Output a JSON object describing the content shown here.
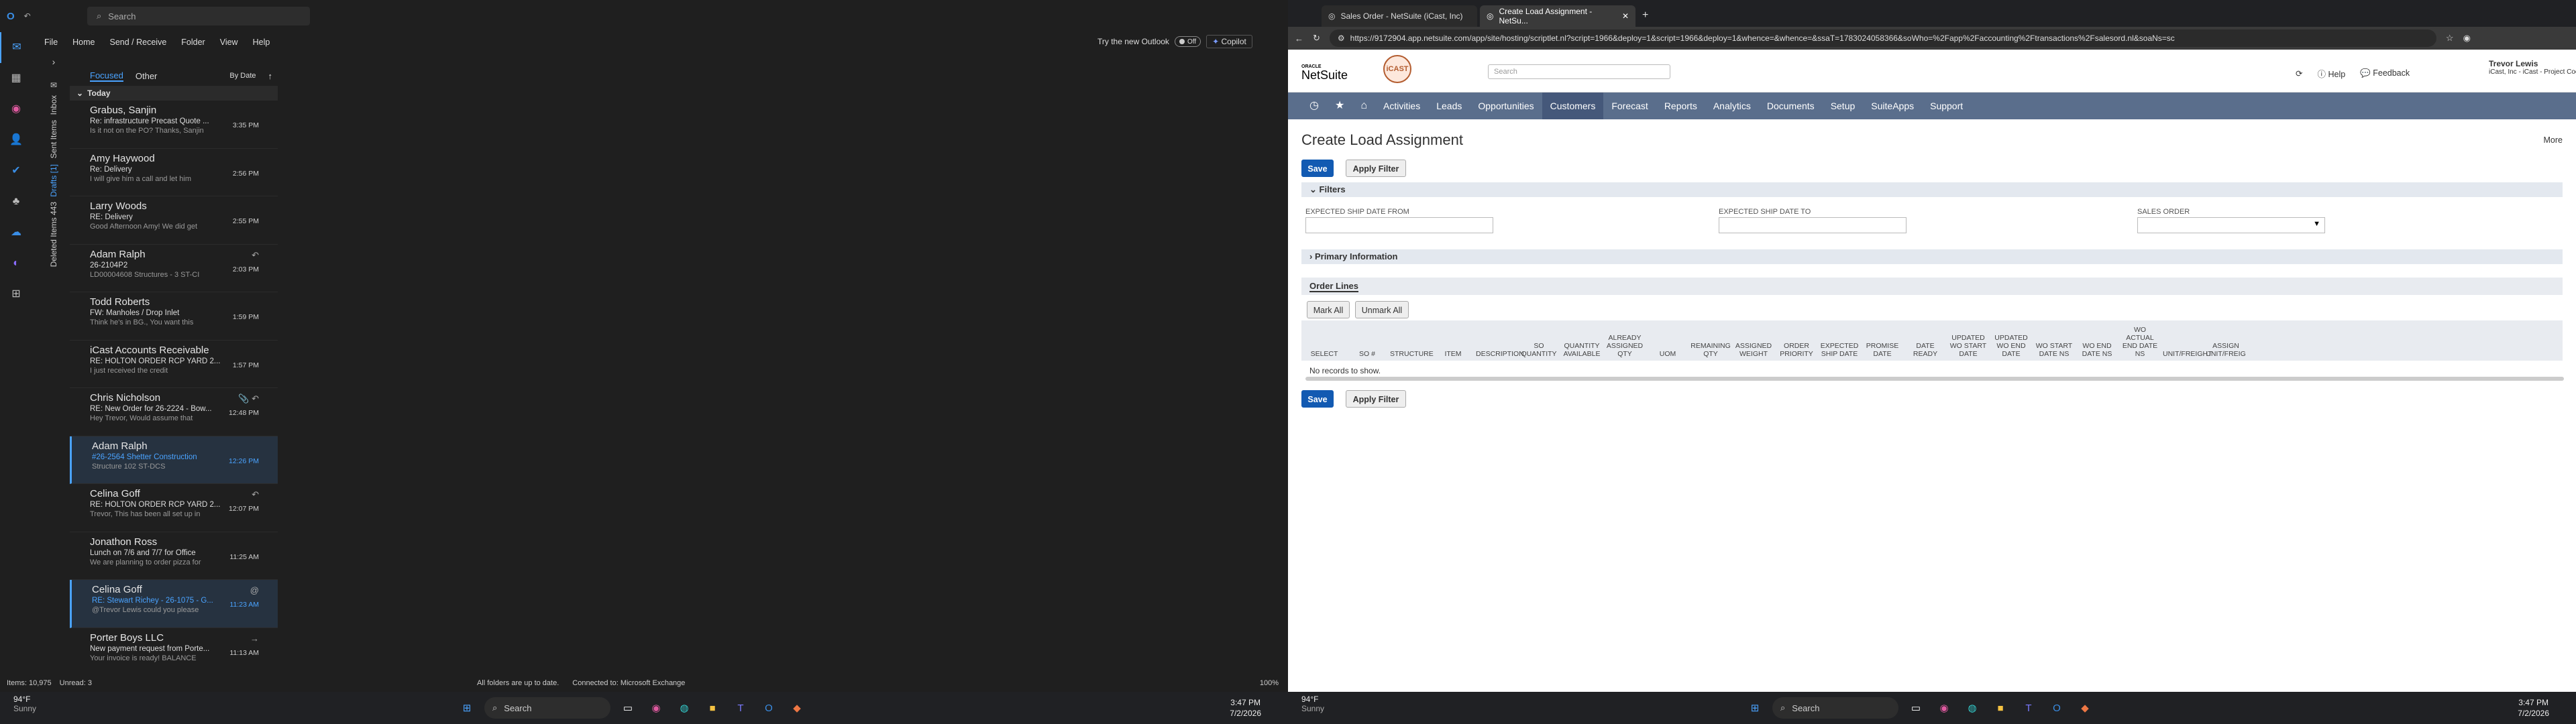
{
  "outlook": {
    "search_placeholder": "Search",
    "menu": [
      "File",
      "Home",
      "Send / Receive",
      "Folder",
      "View",
      "Help"
    ],
    "try_new": "Try the new Outlook",
    "toggle": "Off",
    "copilot": "Copilot",
    "folders": [
      "Inbox",
      "Sent Items",
      "Drafts [1]",
      "Deleted Items 443"
    ],
    "tabs": {
      "focused": "Focused",
      "other": "Other",
      "sort": "By Date"
    },
    "group_today": "Today",
    "messages": [
      {
        "sender": "Grabus, Sanjin",
        "subject": "Re: infrastructure Precast Quote ...",
        "preview": "Is it not on the PO? Thanks, Sanjin",
        "time": "3:35 PM",
        "icon": ""
      },
      {
        "sender": "Amy Haywood",
        "subject": "Re: Delivery",
        "preview": "I will give him a call and let him",
        "time": "2:56 PM",
        "icon": ""
      },
      {
        "sender": "Larry Woods",
        "subject": "RE: Delivery",
        "preview": "Good Afternoon Amy! We did get",
        "time": "2:55 PM",
        "icon": ""
      },
      {
        "sender": "Adam Ralph",
        "subject": "26-2104P2",
        "preview": "LD00004608 Structures - 3 ST-CI",
        "time": "2:03 PM",
        "icon": "↶"
      },
      {
        "sender": "Todd Roberts",
        "subject": "FW: Manholes / Drop Inlet",
        "preview": "Think he's in BG., You want this",
        "time": "1:59 PM",
        "icon": ""
      },
      {
        "sender": "iCast Accounts Receivable",
        "subject": "RE: HOLTON ORDER RCP  YARD 2...",
        "preview": "I just received the credit",
        "time": "1:57 PM",
        "icon": ""
      },
      {
        "sender": "Chris Nicholson",
        "subject": "RE: New Order for 26-2224 - Bow...",
        "preview": "Hey Trevor, Would assume that",
        "time": "12:48 PM",
        "icon": "📎 ↶"
      },
      {
        "sender": "Adam Ralph",
        "subject": "#26-2564 Shetter Construction",
        "preview": "Structure 102 ST-DCS",
        "time": "12:26 PM",
        "icon": "",
        "selected": true
      },
      {
        "sender": "Celina Goff",
        "subject": "RE: HOLTON ORDER RCP  YARD 2...",
        "preview": "Trevor, This has been all set up in",
        "time": "12:07 PM",
        "icon": "↶"
      },
      {
        "sender": "Jonathon Ross",
        "subject": "Lunch on 7/6 and 7/7 for Office",
        "preview": "We are planning to order pizza for",
        "time": "11:25 AM",
        "icon": ""
      },
      {
        "sender": "Celina Goff",
        "subject": "RE: Stewart Richey - 26-1075 - G...",
        "preview": "@Trevor Lewis could you please",
        "time": "11:23 AM",
        "icon": "@",
        "selected": true
      },
      {
        "sender": "Porter Boys LLC",
        "subject": "New payment request from Porte...",
        "preview": "Your invoice is ready! BALANCE",
        "time": "11:13 AM",
        "icon": "→"
      }
    ],
    "status": {
      "items": "Items: 10,975",
      "unread": "Unread: 3",
      "uptodate": "All folders are up to date.",
      "connected": "Connected to: Microsoft Exchange",
      "zoom": "100%"
    }
  },
  "edge": {
    "tabs": [
      {
        "label": "Sales Order - NetSuite (iCast, Inc)"
      },
      {
        "label": "Create Load Assignment - NetSu..."
      }
    ],
    "url": "https://9172904.app.netsuite.com/app/site/hosting/scriptlet.nl?script=1966&deploy=1&script=1966&deploy=1&whence=&whence=&ssaT=1783024058366&soWho=%2Fapp%2Faccounting%2Ftransactions%2Fsalesord.nl&soaNs=sc"
  },
  "netsuite": {
    "brand_top": "ORACLE",
    "brand": "NetSuite",
    "badge": "iCAST",
    "search_placeholder": "Search",
    "help": "Help",
    "feedback": "Feedback",
    "user_name": "Trevor Lewis",
    "user_role": "iCast, Inc - iCast - Project Coordi",
    "nav": [
      "Activities",
      "Leads",
      "Opportunities",
      "Customers",
      "Forecast",
      "Reports",
      "Analytics",
      "Documents",
      "Setup",
      "SuiteApps",
      "Support"
    ],
    "page_title": "Create Load Assignment",
    "more": "More",
    "save": "Save",
    "apply_filter": "Apply Filter",
    "filters_label": "Filters",
    "field_ship_from": "EXPECTED SHIP DATE FROM",
    "field_ship_to": "EXPECTED SHIP DATE TO",
    "field_sales_order": "SALES ORDER",
    "primary_info": "Primary Information",
    "order_lines": "Order Lines",
    "mark_all": "Mark All",
    "unmark_all": "Unmark All",
    "columns": [
      "SELECT",
      "SO #",
      "STRUCTURE",
      "ITEM",
      "DESCRIPTION",
      "SO QUANTITY",
      "QUANTITY AVAILABLE",
      "ALREADY ASSIGNED QTY",
      "UOM",
      "REMAINING QTY",
      "ASSIGNED WEIGHT",
      "ORDER PRIORITY",
      "EXPECTED SHIP DATE",
      "PROMISE DATE",
      "DATE READY",
      "UPDATED WO START DATE",
      "UPDATED WO END DATE",
      "WO START DATE NS",
      "WO END DATE NS",
      "WO ACTUAL END DATE NS",
      "UNIT/FREIGHT",
      "ASSIGN UNIT/FREIG"
    ],
    "no_records": "No records to show."
  },
  "taskbar": {
    "weather_temp": "94°F",
    "weather_desc": "Sunny",
    "search": "Search",
    "time": "3:47 PM",
    "date": "7/2/2026"
  }
}
